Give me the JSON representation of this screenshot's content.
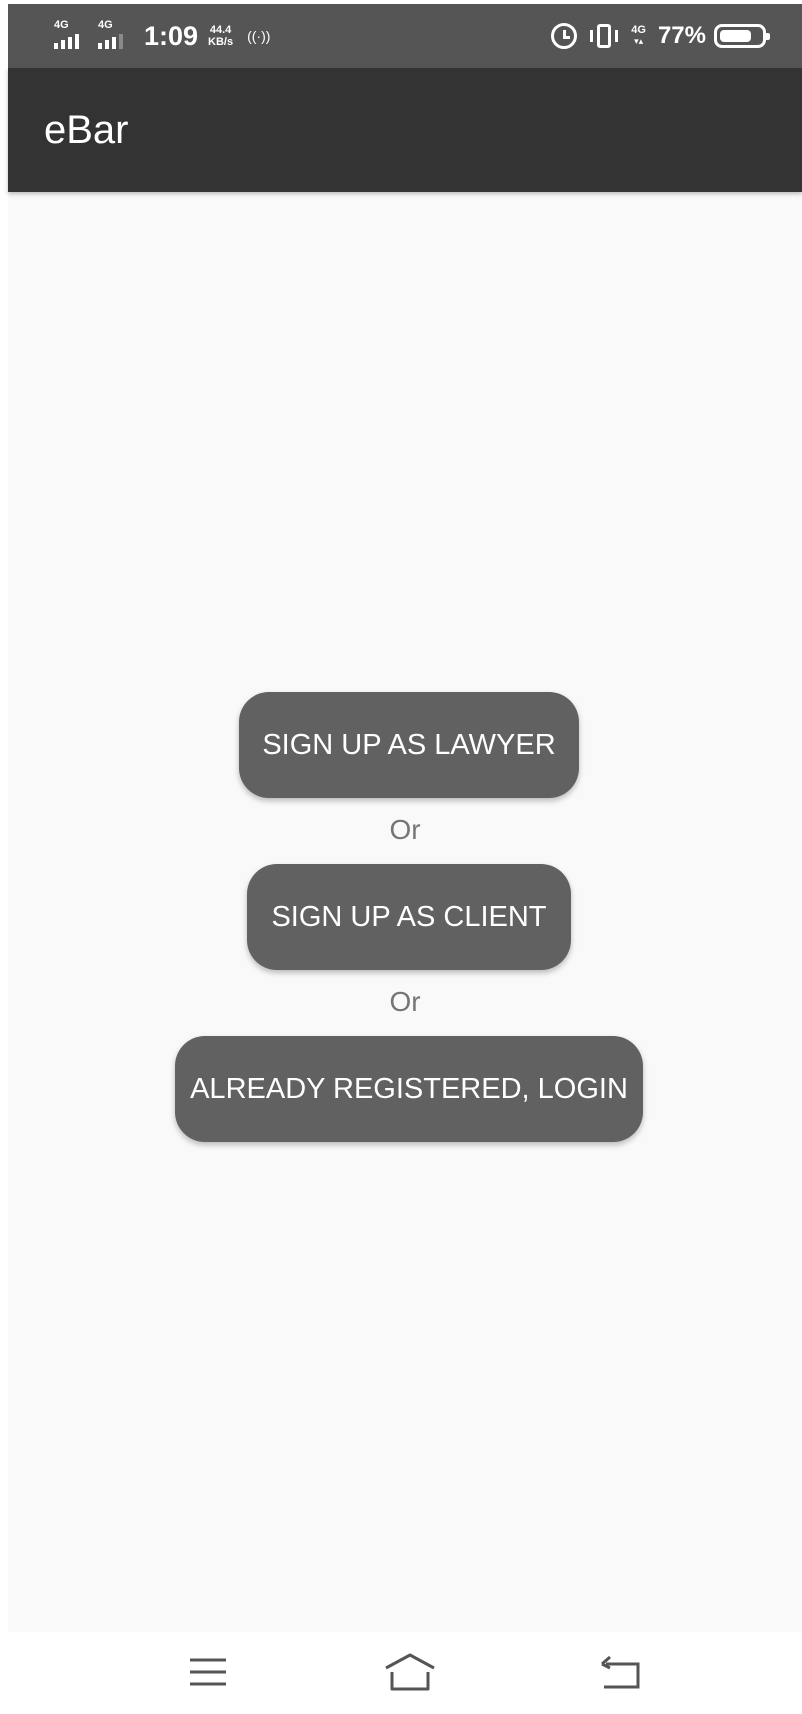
{
  "status_bar": {
    "network_1": "4G",
    "network_2": "4G",
    "time": "1:09",
    "speed_value": "44.4",
    "speed_unit": "KB/s",
    "hotspot_symbol": "((·))",
    "network_3": "4G",
    "battery_percent": "77%",
    "battery_level": 0.77
  },
  "app_bar": {
    "title": "eBar"
  },
  "main": {
    "signup_lawyer_label": "SIGN UP AS LAWYER",
    "or_1": "Or",
    "signup_client_label": "SIGN UP AS CLIENT",
    "or_2": "Or",
    "login_label": "ALREADY REGISTERED, LOGIN"
  },
  "nav_bar": {
    "icons": [
      "menu-icon",
      "home-icon",
      "back-icon"
    ]
  },
  "colors": {
    "status_bar": "#555555",
    "app_bar": "#333333",
    "background": "#f9f9f9",
    "button": "#616161",
    "button_text": "#ffffff",
    "or_text": "#757575",
    "nav_icon": "#555555"
  }
}
